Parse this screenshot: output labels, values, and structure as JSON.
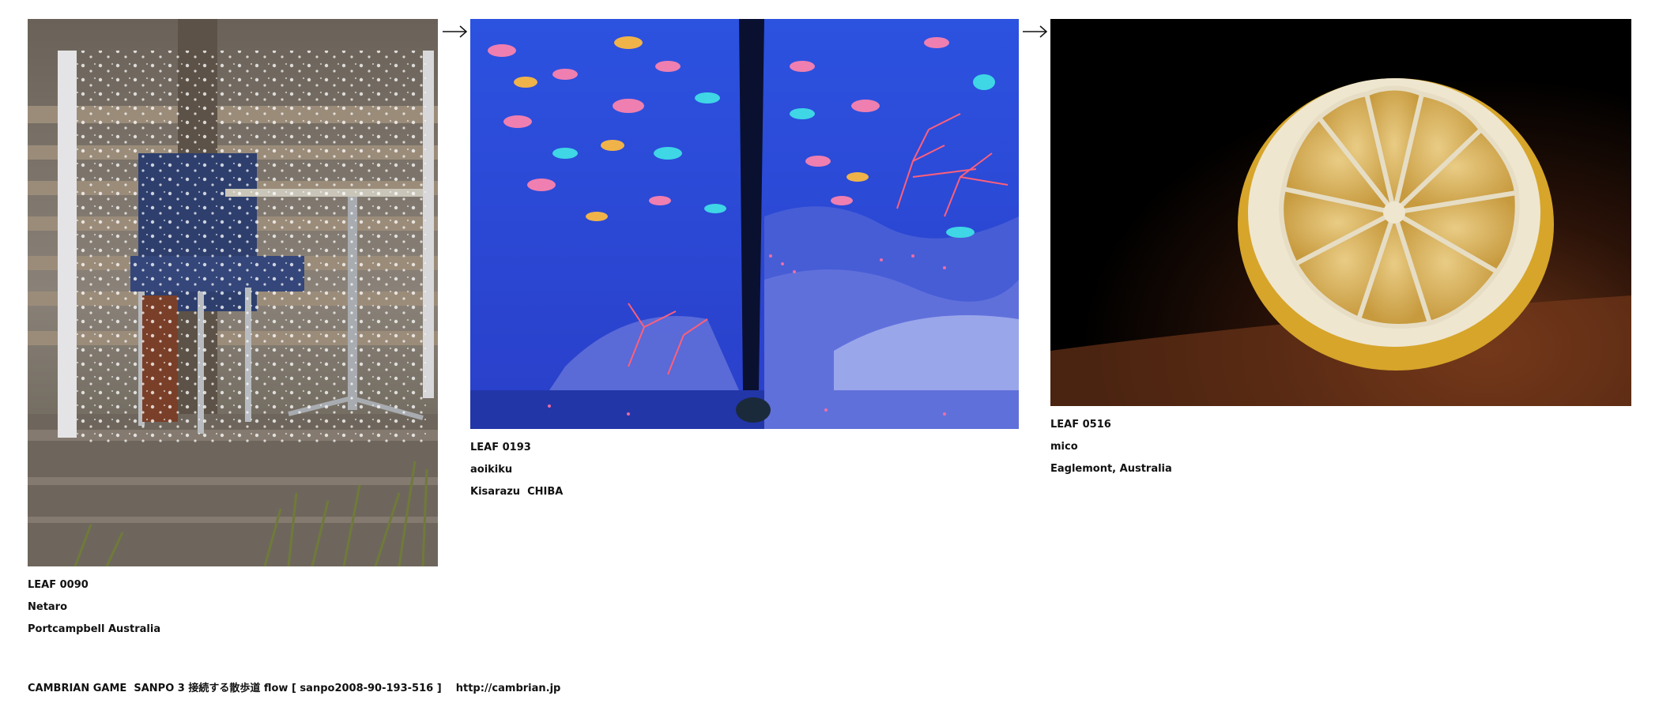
{
  "leaves": [
    {
      "id": "LEAF 0090",
      "author": "Netaro",
      "location": "Portcampbell Australia"
    },
    {
      "id": "LEAF 0193",
      "author": "aoikiku",
      "location": "Kisarazu  CHIBA"
    },
    {
      "id": "LEAF 0516",
      "author": "mico",
      "location": "Eaglemont, Australia"
    }
  ],
  "arrows": [
    "arrow-right-icon",
    "arrow-right-icon"
  ],
  "footer": {
    "text": "CAMBRIAN GAME  SANPO 3 接続する散歩道 flow [ sanpo2008-90-193-516 ]",
    "link": "http://cambrian.jp"
  }
}
